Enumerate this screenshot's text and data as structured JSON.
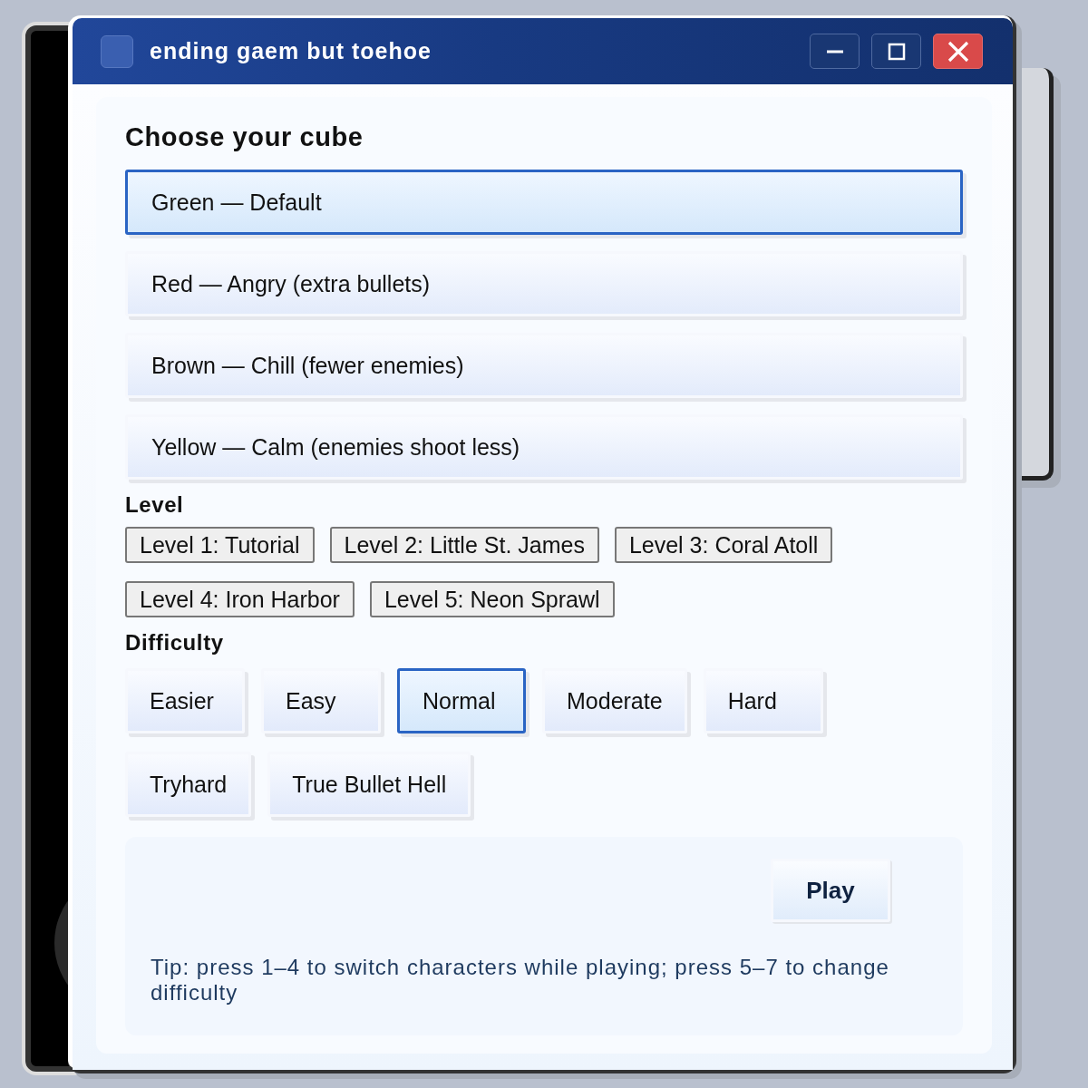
{
  "window": {
    "title": "ending gaem but toehoe"
  },
  "cube": {
    "heading": "Choose your cube",
    "options": [
      {
        "label": "Green — Default",
        "selected": true
      },
      {
        "label": "Red — Angry (extra bullets)",
        "selected": false
      },
      {
        "label": "Brown — Chill (fewer enemies)",
        "selected": false
      },
      {
        "label": "Yellow — Calm (enemies shoot less)",
        "selected": false
      }
    ]
  },
  "level": {
    "heading": "Level",
    "options": [
      {
        "label": "Level 1: Tutorial",
        "selected": false
      },
      {
        "label": "Level 2: Little St. James",
        "selected": false
      },
      {
        "label": "Level 3: Coral Atoll",
        "selected": false
      },
      {
        "label": "Level 4: Iron Harbor",
        "selected": false
      },
      {
        "label": "Level 5: Neon Sprawl",
        "selected": false
      }
    ]
  },
  "difficulty": {
    "heading": "Difficulty",
    "options": [
      {
        "label": "Easier",
        "selected": false
      },
      {
        "label": "Easy",
        "selected": false
      },
      {
        "label": "Normal",
        "selected": true
      },
      {
        "label": "Moderate",
        "selected": false
      },
      {
        "label": "Hard",
        "selected": false
      },
      {
        "label": "Tryhard",
        "selected": false
      },
      {
        "label": "True Bullet Hell",
        "selected": false
      }
    ]
  },
  "play_button": {
    "label": "Play"
  },
  "tip": "Tip: press 1–4 to switch characters while playing; press 5–7 to change difficulty"
}
